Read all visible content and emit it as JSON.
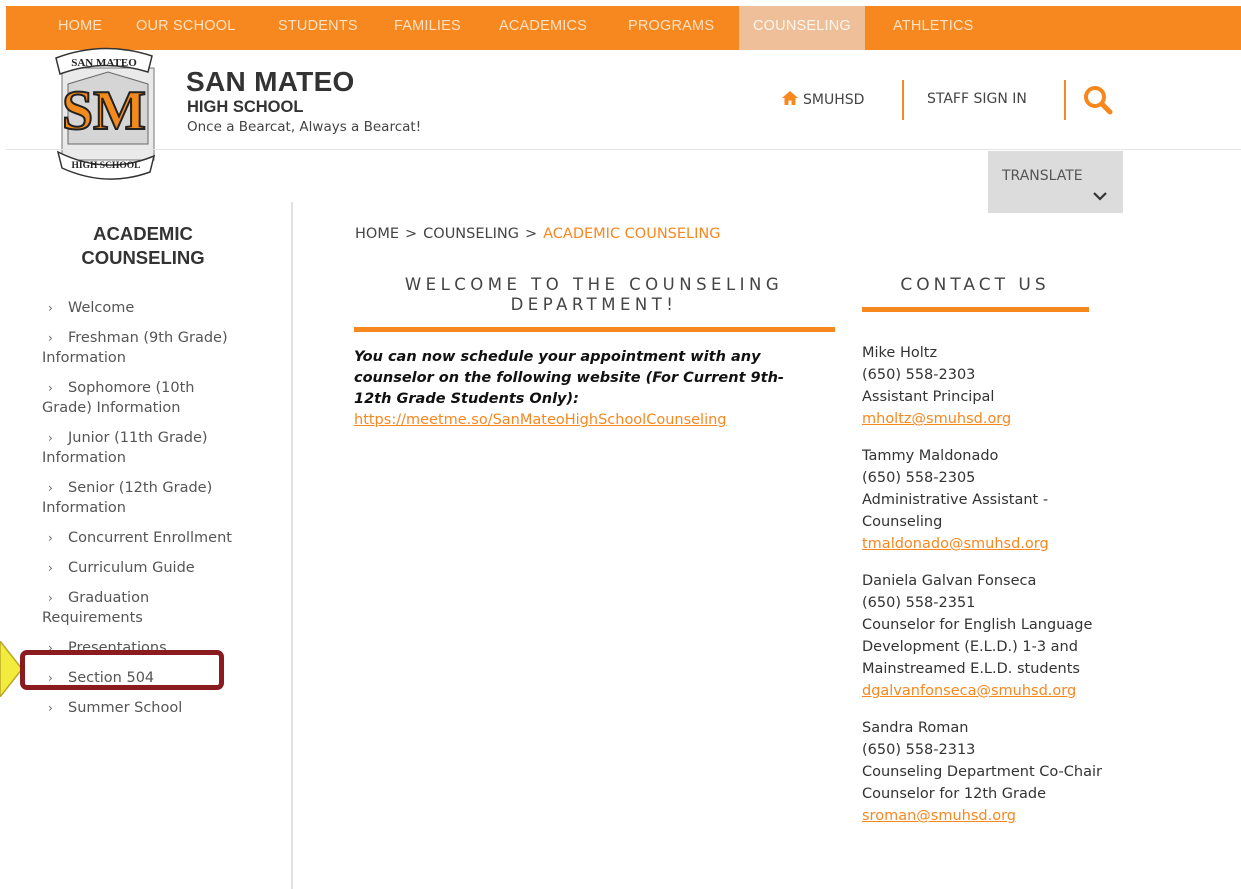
{
  "nav": {
    "items": [
      "HOME",
      "OUR SCHOOL",
      "STUDENTS",
      "FAMILIES",
      "ACADEMICS",
      "PROGRAMS",
      "COUNSELING",
      "ATHLETICS"
    ],
    "active": "COUNSELING"
  },
  "header": {
    "logo_text_top": "SAN MATEO",
    "logo_text_bottom": "HIGH SCHOOL",
    "logo_monogram": "SM",
    "school_name": "SAN MATEO",
    "school_sub": "HIGH SCHOOL",
    "motto": "Once a Bearcat, Always a Bearcat!",
    "smuhsd_label": "SMUHSD",
    "staff_signin_label": "STAFF SIGN IN",
    "translate_label": "TRANSLATE"
  },
  "sidebar": {
    "title": "ACADEMIC COUNSELING",
    "items": [
      "Welcome",
      "Freshman (9th Grade) Information",
      "Sophomore (10th Grade) Information",
      "Junior (11th Grade) Information",
      "Senior (12th Grade) Information",
      "Concurrent Enrollment",
      "Curriculum Guide",
      "Graduation Requirements",
      "Presentations",
      "Section 504",
      "Summer School"
    ]
  },
  "breadcrumb": {
    "home": "HOME",
    "section": "COUNSELING",
    "current": "ACADEMIC COUNSELING",
    "separator": ">"
  },
  "main": {
    "heading": "WELCOME TO THE COUNSELING DEPARTMENT!",
    "notice": "You can now schedule your appointment with any counselor on the following website (For Current 9th-12th Grade Students Only):",
    "link": "https://meetme.so/SanMateoHighSchoolCounseling"
  },
  "contact": {
    "title": "CONTACT US",
    "people": [
      {
        "name": "Mike Holtz",
        "phone": "(650) 558-2303",
        "role": "Assistant Principal",
        "email": "mholtz@smuhsd.org"
      },
      {
        "name": "Tammy Maldonado",
        "phone": "(650) 558-2305",
        "role": "Administrative Assistant - Counseling",
        "email": "tmaldonado@smuhsd.org"
      },
      {
        "name": "Daniela Galvan Fonseca",
        "phone": "(650) 558-2351",
        "role": "Counselor for English Language Development (E.L.D.) 1-3 and Mainstreamed E.L.D. students",
        "email": "dgalvanfonseca@smuhsd.org"
      },
      {
        "name": "Sandra Roman",
        "phone": "(650) 558-2313",
        "role": "Counseling Department Co-Chair",
        "role2": "Counselor for 12th Grade",
        "email": "sroman@smuhsd.org"
      }
    ]
  },
  "colors": {
    "accent": "#f7871f",
    "highlight": "#8a1c20",
    "arrow": "#f4ec3d"
  },
  "icons": {
    "home": "home-icon",
    "search": "search-icon",
    "chevron": "chevron-down-icon",
    "arrow": "chevron-right-icon"
  }
}
